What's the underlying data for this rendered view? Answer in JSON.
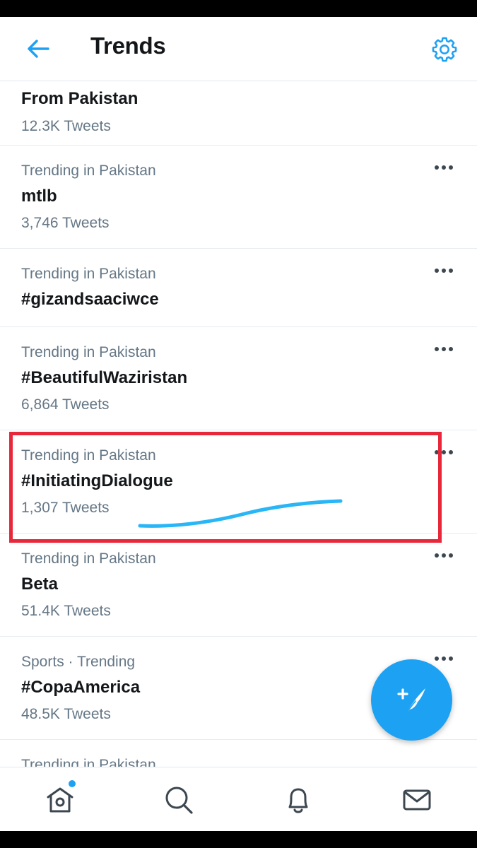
{
  "header": {
    "title": "Trends",
    "back_icon": "arrow-left-icon",
    "settings_icon": "gear-icon",
    "accent_color": "#1da1f2"
  },
  "trends": [
    {
      "context": "",
      "name": "From Pakistan",
      "count": "12.3K Tweets"
    },
    {
      "context": "Trending in Pakistan",
      "name": "mtlb",
      "count": "3,746 Tweets"
    },
    {
      "context": "Trending in Pakistan",
      "name": "#gizandsaaciwce",
      "count": ""
    },
    {
      "context": "Trending in Pakistan",
      "name": "#BeautifulWaziristan",
      "count": "6,864 Tweets"
    },
    {
      "context": "Trending in Pakistan",
      "name": "#InitiatingDialogue",
      "count": "1,307 Tweets"
    },
    {
      "context": "Trending in Pakistan",
      "name": "Beta",
      "count": "51.4K Tweets"
    },
    {
      "context": "Sports · Trending",
      "name": "#CopaAmerica",
      "count": "48.5K Tweets"
    },
    {
      "context": "Trending in Pakistan",
      "name": "",
      "count": ""
    }
  ],
  "annotation": {
    "highlight_color": "#e8283a",
    "underline_color": "#29b6f6"
  },
  "fab": {
    "icon": "compose-tweet-icon"
  },
  "bottom_nav": {
    "items": [
      {
        "icon": "home-icon",
        "has_notification_dot": true
      },
      {
        "icon": "search-icon"
      },
      {
        "icon": "bell-icon"
      },
      {
        "icon": "mail-icon"
      }
    ]
  }
}
